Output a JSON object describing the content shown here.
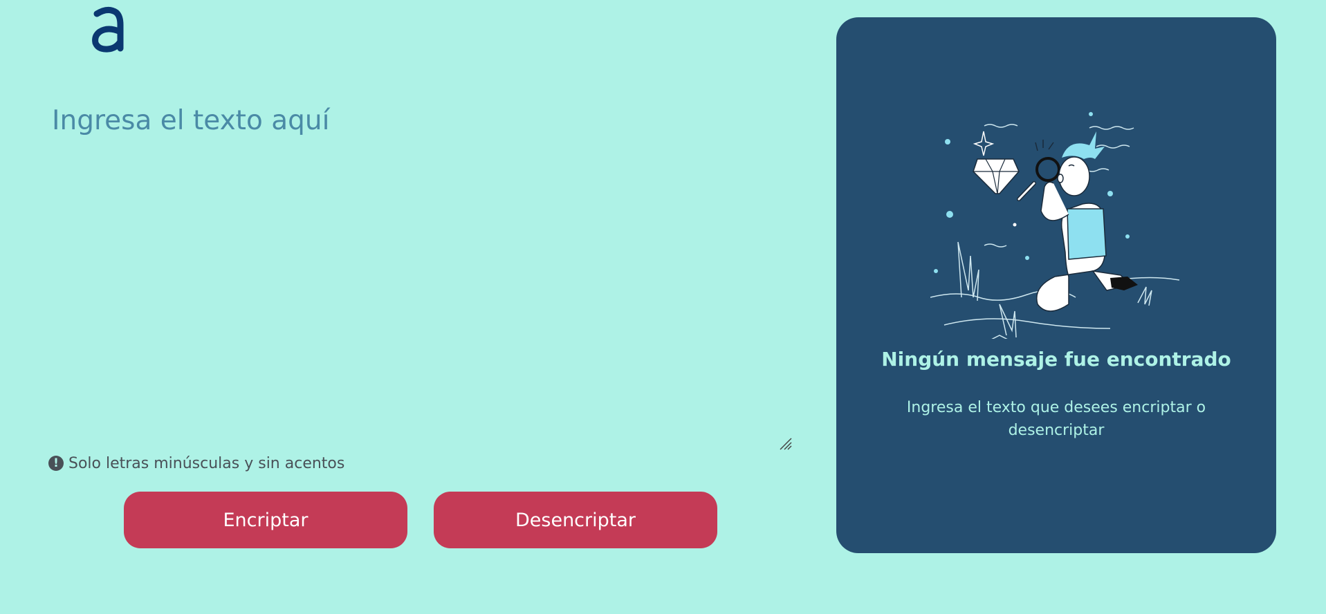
{
  "logo": {
    "letter": "a"
  },
  "input": {
    "placeholder": "Ingresa el texto aquí",
    "value": ""
  },
  "hint": {
    "icon": "exclamation-circle-icon",
    "text": "Solo letras minúsculas y sin acentos"
  },
  "buttons": {
    "encrypt_label": "Encriptar",
    "decrypt_label": "Desencriptar"
  },
  "output_panel": {
    "illustration": "person-searching-diamond-illustration",
    "title": "Ningún mensaje fue encontrado",
    "description": "Ingresa el texto que desees encriptar o desencriptar"
  },
  "colors": {
    "background": "#aef2e6",
    "button": "#c43b56",
    "panel": "#254e70",
    "panel_text": "#aef2e6",
    "logo": "#0a3871",
    "placeholder": "#4a8aa6"
  }
}
